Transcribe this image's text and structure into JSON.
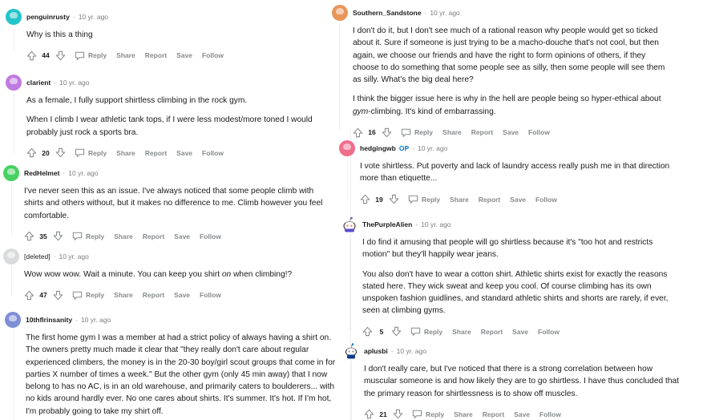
{
  "actions": {
    "reply": "Reply",
    "share": "Share",
    "report": "Report",
    "save": "Save",
    "follow": "Follow"
  },
  "colors": {
    "username": "#1c1c1c",
    "meta": "#7c7c7c",
    "action": "#878a8c",
    "op_badge": "#0079d3"
  },
  "left": [
    {
      "user": "penguinrusty",
      "time": "10 yr. ago",
      "avatar_color": "#24c4c9",
      "paragraphs": [
        "Why is this a thing"
      ],
      "score": "44"
    },
    {
      "user": "clarient",
      "time": "10 yr. ago",
      "avatar_color": "#c07be0",
      "paragraphs": [
        "As a female, I fully support shirtless climbing in the rock gym.",
        "When I climb I wear athletic tank tops, if I were less modest/more toned I would probably just rock a sports bra."
      ],
      "score": "20"
    },
    {
      "user": "RedHelmet",
      "time": "10 yr. ago",
      "avatar_color": "#46d160",
      "paragraphs": [
        "I've never seen this as an issue. I've always noticed that some people climb with shirts and others without, but it makes no difference to me. Climb however you feel comfortable."
      ],
      "score": "35"
    },
    {
      "user": "[deleted]",
      "time": "10 yr. ago",
      "avatar_color": "#d9dbdc",
      "paragraphs": [
        "Wow wow wow. Wait a minute. You can keep you shirt on when climbing!?"
      ],
      "score": "47"
    },
    {
      "user": "10thflrinsanity",
      "time": "10 yr. ago",
      "avatar_color": "#7e8fd6",
      "paragraphs": [
        "The first home gym I was a member at had a strict policy of always having a shirt on. The owners pretty much made it clear that \"they really don't care about regular experienced climbers, the money is in the 20-30 boy/girl scout groups that come in for parties X number of times a week.\" But the other gym (only 45 min away) that I now belong to has no AC, is in an old warehouse, and primarily caters to boulderers... with no kids around hardly ever. No one cares about shirts. It's summer. It's hot. If I'm hot, I'm probably going to take my shirt off."
      ]
    }
  ],
  "right": [
    {
      "user": "Southern_Sandstone",
      "time": "10 yr. ago",
      "avatar_color": "#e8965a",
      "paragraphs": [
        "I don't do it, but I don't see much of a rational reason why people would get so ticked about it. Sure if someone is just trying to be a macho-douche that's not cool, but then again, we choose our friends and have the right to form opinions of others, if they choose to do something that some people see as silly, then some people will see them as silly. What's the big deal here?",
        "I think the bigger issue here is why in the hell are people being so hyper-ethical about gym-climbing. It's kind of embarrassing."
      ],
      "score": "16"
    },
    {
      "user": "hedgingwb",
      "op": "OP",
      "time": "10 yr. ago",
      "avatar_color": "#ef6e8a",
      "paragraphs": [
        "I vote shirtless. Put poverty and lack of laundry access really push me in that direction more than etiquette..."
      ],
      "score": "19"
    },
    {
      "user": "ThePurpleAlien",
      "time": "10 yr. ago",
      "avatar_color": "#ffffff",
      "avatar_icon": "snoo-icon",
      "paragraphs": [
        "I do find it amusing that people will go shirtless because it's \"too hot and restricts motion\" but they'll happily wear jeans.",
        "You also don't have to wear a cotton shirt. Athletic shirts exist for exactly the reasons stated here. They wick sweat and keep you cool. Of course climbing has its own unspoken fashion guidlines, and standard athletic shirts and shorts are rarely, if ever, seen at climbing gyms."
      ],
      "score": "5"
    },
    {
      "user": "aplusbi",
      "time": "10 yr. ago",
      "avatar_color": "#ffffff",
      "avatar_icon": "snoo-icon",
      "paragraphs": [
        "I don't really care, but I've noticed that there is a strong correlation between how muscular someone is and how likely they are to go shirtless. I have thus concluded that the primary reason for shirtlessness is to show off muscles."
      ],
      "score": "21"
    }
  ]
}
